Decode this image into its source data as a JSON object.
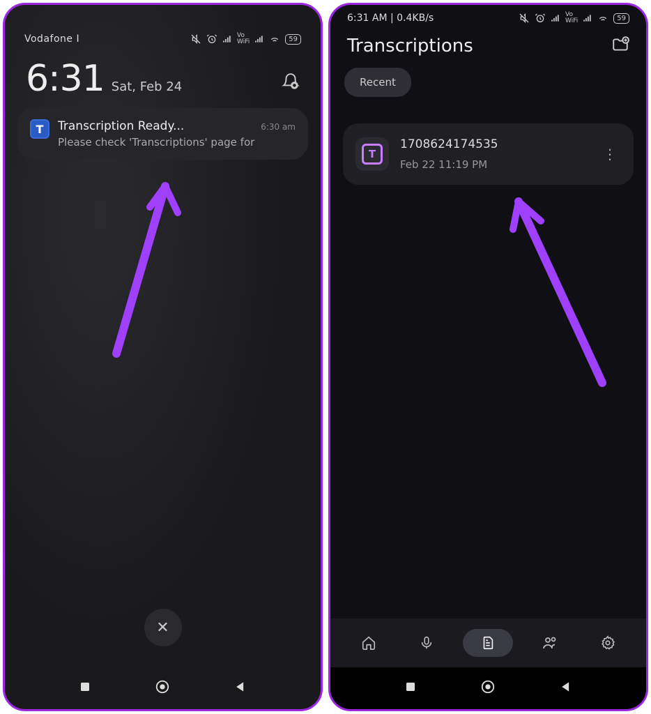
{
  "left": {
    "carrier": "Vodafone I",
    "battery": "59",
    "time": "6:31",
    "date": "Sat, Feb 24",
    "notification": {
      "icon_letter": "T",
      "title": "Transcription Ready...",
      "time": "6:30 am",
      "text": "Please check 'Transcriptions' page for"
    },
    "dismiss": "✕"
  },
  "right": {
    "status_text": "6:31 AM | 0.4KB/s",
    "battery": "59",
    "header_title": "Transcriptions",
    "chip_recent": "Recent",
    "item": {
      "icon_letter": "T",
      "title": "1708624174535",
      "sub": "Feb 22 11:19 PM",
      "more": "⋮"
    }
  }
}
